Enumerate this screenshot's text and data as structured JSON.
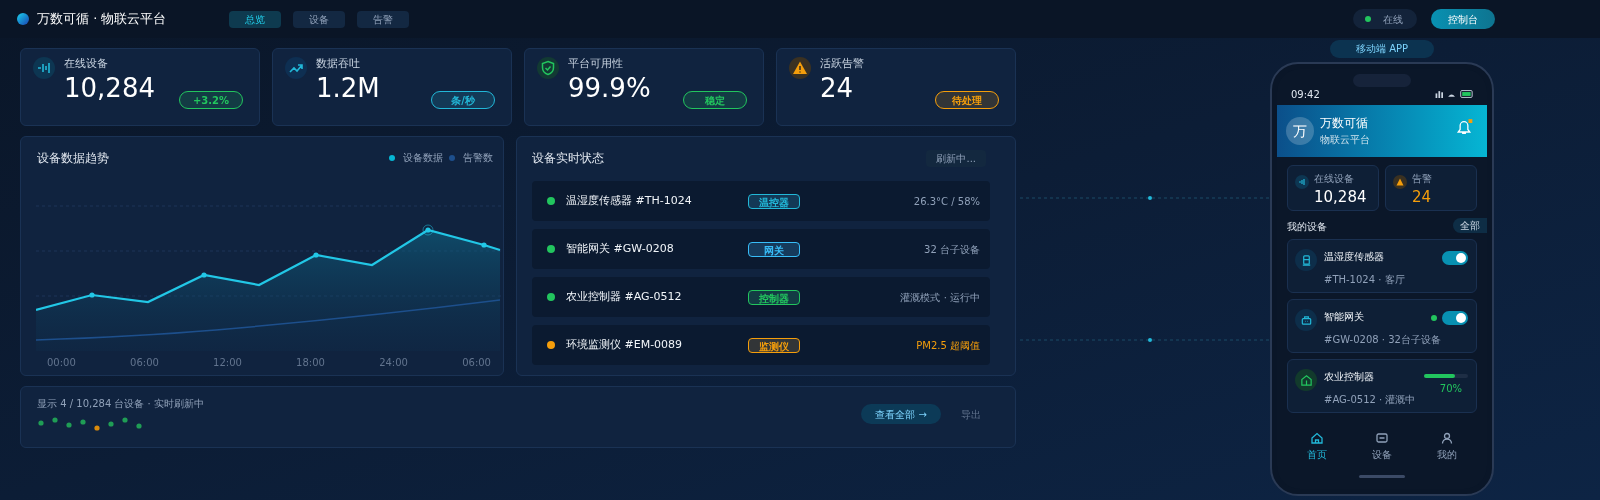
{
  "header": {
    "title": "万数可循 · 物联云平台",
    "nav": [
      {
        "label": "总览",
        "selected": true
      },
      {
        "label": "设备",
        "selected": false
      },
      {
        "label": "告警",
        "selected": false
      }
    ],
    "status": {
      "label": "在线",
      "online": true
    },
    "console_button": "控制台"
  },
  "stats": [
    {
      "kind": "devices",
      "label": "在线设备",
      "value": "10,284",
      "badge": "+3.2%",
      "color": "#22c55e"
    },
    {
      "kind": "throughput",
      "label": "数据吞吐",
      "value": "1.2M",
      "badge": "条/秒",
      "color": "#22b8d8"
    },
    {
      "kind": "availability",
      "label": "平台可用性",
      "value": "99.9%",
      "badge": "稳定",
      "color": "#22c55e"
    },
    {
      "kind": "alerts",
      "label": "活跃告警",
      "value": "24",
      "badge": "待处理",
      "color": "#f59e0b"
    }
  ],
  "trend": {
    "title": "设备数据趋势",
    "legend": [
      {
        "label": "设备数据",
        "color": "#06b6d4"
      },
      {
        "label": "告警数",
        "color": "#1d4f8c"
      }
    ],
    "x_labels": [
      "00:00",
      "06:00",
      "12:00",
      "18:00",
      "24:00",
      "06:00"
    ]
  },
  "status_panel": {
    "title": "设备实时状态",
    "refresh": "刷新中...",
    "devices": [
      {
        "name": "温湿度传感器 #TH-1024",
        "tag": {
          "label": "温控器",
          "color": "#22b8d8"
        },
        "reading": "26.3°C / 58%",
        "alert": false,
        "color": "#22c55e"
      },
      {
        "name": "智能网关 #GW-0208",
        "tag": {
          "label": "网关",
          "color": "#38bdf8"
        },
        "reading": "32 台子设备",
        "alert": false,
        "color": "#22c55e"
      },
      {
        "name": "农业控制器 #AG-0512",
        "tag": {
          "label": "控制器",
          "color": "#22c55e"
        },
        "reading": "灌溉模式 · 运行中",
        "alert": false,
        "color": "#22c55e"
      },
      {
        "name": "环境监测仪 #EM-0089",
        "tag": {
          "label": "监测仪",
          "color": "#f59e0b"
        },
        "reading": "PM2.5 超阈值",
        "alert": true,
        "color": "#f59e0b"
      }
    ]
  },
  "footer": {
    "summary": "显示 4 / 10,284 台设备 · 实时刷新中",
    "view_all": "查看全部 →",
    "export": "导出"
  },
  "mobile": {
    "label": "移动端 APP",
    "time": "09:42",
    "app_icon": "万",
    "app_name": "万数可循",
    "subtitle": "物联云平台",
    "stats": [
      {
        "label": "在线设备",
        "value": "10,284",
        "alert": false
      },
      {
        "label": "告警",
        "value": "24",
        "alert": true
      }
    ],
    "section": "我的设备",
    "all": "全部",
    "devices": [
      {
        "kind": "toggle",
        "name": "温湿度传感器",
        "meta": "#TH-1024 · 客厅",
        "on": true,
        "online": false
      },
      {
        "kind": "toggle",
        "name": "智能网关",
        "meta": "#GW-0208 · 32台子设备",
        "on": true,
        "online": true
      },
      {
        "kind": "progress",
        "name": "农业控制器",
        "meta": "#AG-0512 · 灌溉中",
        "level": 0.7,
        "reading": "70%"
      }
    ],
    "tabs": [
      {
        "label": "首页",
        "selected": true
      },
      {
        "label": "设备",
        "selected": false
      },
      {
        "label": "我的",
        "selected": false
      }
    ]
  }
}
